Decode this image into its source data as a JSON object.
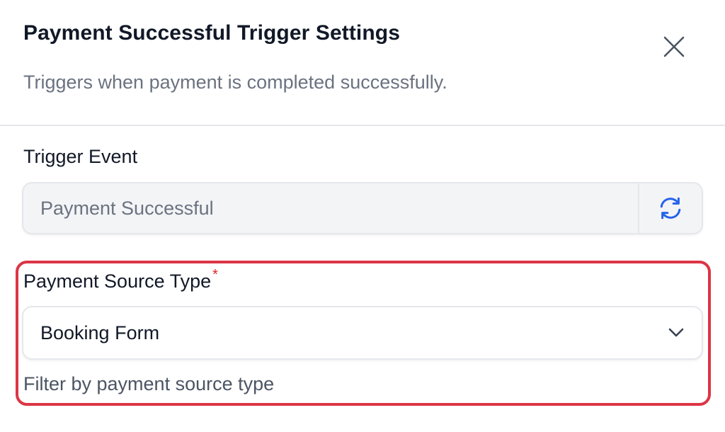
{
  "dialog": {
    "title": "Payment Successful Trigger Settings",
    "subtitle": "Triggers when payment is completed successfully.",
    "close_icon": "close-icon"
  },
  "trigger_event": {
    "label": "Trigger Event",
    "value": "Payment Successful",
    "refresh_icon": "refresh-icon",
    "icon_color": "#2563eb"
  },
  "payment_source": {
    "label": "Payment Source Type",
    "required_marker": "*",
    "selected": "Booking Form",
    "helper": "Filter by payment source type",
    "highlight_color": "#dc3545"
  }
}
